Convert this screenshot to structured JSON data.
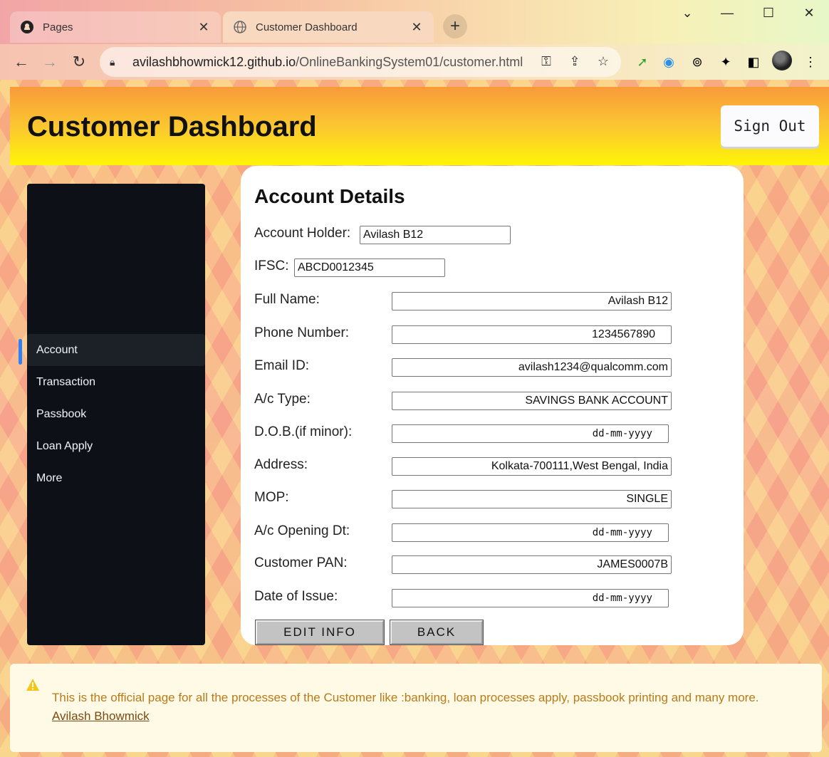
{
  "browser": {
    "tabs": [
      {
        "title": "Pages",
        "icon": "github-icon",
        "active": false
      },
      {
        "title": "Customer Dashboard",
        "icon": "globe-icon",
        "active": true
      }
    ],
    "address": {
      "host": "avilashbhowmick12.github.io",
      "path": "/OnlineBankingSystem01/customer.html"
    }
  },
  "header": {
    "title": "Customer Dashboard",
    "sign_out_label": "Sign Out"
  },
  "sidebar": {
    "items": [
      {
        "label": "Account",
        "active": true
      },
      {
        "label": "Transaction"
      },
      {
        "label": "Passbook"
      },
      {
        "label": "Loan Apply"
      },
      {
        "label": "More"
      }
    ]
  },
  "account": {
    "heading": "Account Details",
    "holder_label": "Account Holder:",
    "holder_value": "Avilash B12",
    "ifsc_label": "IFSC:",
    "ifsc_value": "ABCD0012345",
    "fields": [
      {
        "label": "Full Name:",
        "value": "Avilash B12",
        "type": "text"
      },
      {
        "label": "Phone Number:",
        "value": "1234567890",
        "type": "number"
      },
      {
        "label": "Email ID:",
        "value": "avilash1234@qualcomm.com",
        "type": "text"
      },
      {
        "label": "A/c Type:",
        "value": "SAVINGS BANK ACCOUNT",
        "type": "text"
      },
      {
        "label": "D.O.B.(if minor):",
        "value": "dd-mm-yyyy",
        "type": "date"
      },
      {
        "label": "Address:",
        "value": "Kolkata-700111,West Bengal, India",
        "type": "text"
      },
      {
        "label": "MOP:",
        "value": "SINGLE",
        "type": "text"
      },
      {
        "label": "A/c Opening Dt:",
        "value": "dd-mm-yyyy",
        "type": "date"
      },
      {
        "label": "Customer PAN:",
        "value": "JAMES0007B",
        "type": "text"
      },
      {
        "label": "Date of Issue:",
        "value": "dd-mm-yyyy",
        "type": "date"
      }
    ],
    "edit_label": "EDIT INFO",
    "back_label": "BACK"
  },
  "footer": {
    "message": "This is the official page for all the processes of the Customer like :banking, loan processes apply, passbook printing and many more.",
    "author_link": "Avilash Bhowmick"
  },
  "colors": {
    "header_top": "#f99a3a",
    "header_bottom": "#fff506",
    "sidebar_bg": "#0d1117",
    "sidebar_marker": "#2f81f7",
    "footer_text": "#b87a1c"
  }
}
